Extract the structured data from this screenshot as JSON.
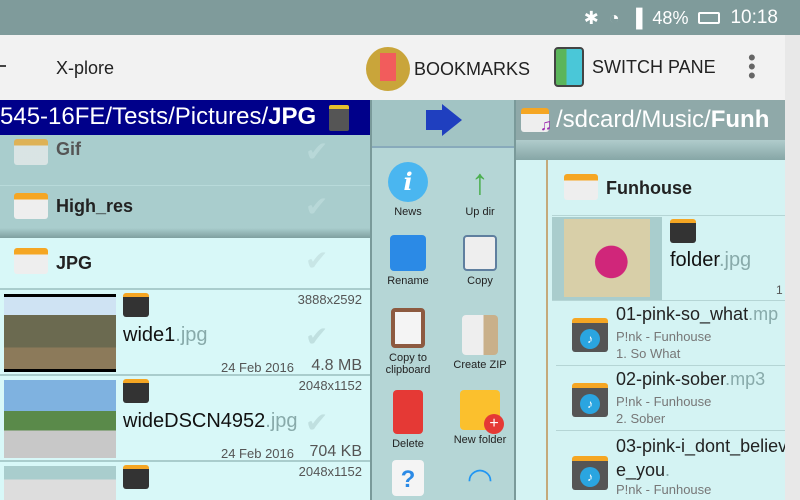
{
  "status": {
    "battery": "48%",
    "time": "10:18",
    "icons": [
      "bluetooth-icon",
      "wifi-icon",
      "signal-icon",
      "battery-charging-icon"
    ]
  },
  "appbar": {
    "title": "X-plore",
    "bookmarks": "BOOKMARKS",
    "switch_pane": "SWITCH PANE"
  },
  "left": {
    "path_prefix": "545-16FE/Tests/Pictures/",
    "path_current": "JPG",
    "folders": [
      {
        "name": "Gif"
      },
      {
        "name": "High_res"
      },
      {
        "name": "JPG"
      }
    ],
    "files": [
      {
        "base": "wide1",
        "ext": ".jpg",
        "resolution": "3888x2592",
        "date": "24 Feb 2016",
        "size": "4.8 MB"
      },
      {
        "base": "wideDSCN4952",
        "ext": ".jpg",
        "resolution": "2048x1152",
        "date": "24 Feb 2016",
        "size": "704 KB"
      },
      {
        "resolution": "2048x1152"
      }
    ]
  },
  "toolbar": {
    "buttons": [
      {
        "label": "News"
      },
      {
        "label": "Up dir"
      },
      {
        "label": "Rename"
      },
      {
        "label": "Copy"
      },
      {
        "label": "Copy to clipboard"
      },
      {
        "label": "Create ZIP"
      },
      {
        "label": "Delete"
      },
      {
        "label": "New folder"
      }
    ]
  },
  "right": {
    "path_prefix": "/sdcard/Music/",
    "path_current": "Funh",
    "folder": "Funhouse",
    "image": {
      "base": "folder",
      "ext": ".jpg",
      "size_partial": "1"
    },
    "songs": [
      {
        "base": "01-pink-so_what",
        "ext": ".mp",
        "artist": "P!nk - Funhouse",
        "track": "1.  So What"
      },
      {
        "base": "02-pink-sober",
        "ext": ".mp3",
        "artist": "P!nk - Funhouse",
        "track": "2.  Sober"
      },
      {
        "base": "03-pink-i_dont_believe_you",
        "ext": ".",
        "artist": "P!nk - Funhouse",
        "track": ""
      }
    ]
  }
}
